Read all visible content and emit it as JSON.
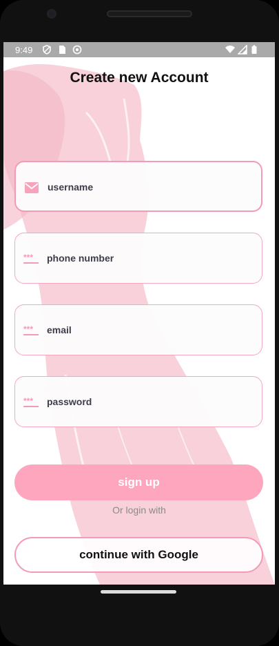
{
  "status_bar": {
    "time": "9:49",
    "left_icons": [
      "shield-icon",
      "sim-card-icon",
      "circle-icon"
    ],
    "right_icons": [
      "wifi-icon",
      "signal-icon",
      "battery-icon"
    ]
  },
  "page": {
    "title": "Create new Account"
  },
  "form": {
    "fields": [
      {
        "name": "username",
        "placeholder": "username",
        "value": "",
        "icon": "mail-icon"
      },
      {
        "name": "phone",
        "placeholder": "phone number",
        "value": "",
        "icon": "password-dots-icon"
      },
      {
        "name": "email",
        "placeholder": "email",
        "value": "",
        "icon": "password-dots-icon"
      },
      {
        "name": "password",
        "placeholder": "password",
        "value": "",
        "icon": "password-dots-icon"
      }
    ]
  },
  "actions": {
    "signup_label": "sign up",
    "or_text": "Or login with",
    "google_label": "continue with Google"
  },
  "colors": {
    "accent": "#ffa6bf",
    "border": "#f39ab6",
    "status_bar": "#a9a9a9"
  }
}
